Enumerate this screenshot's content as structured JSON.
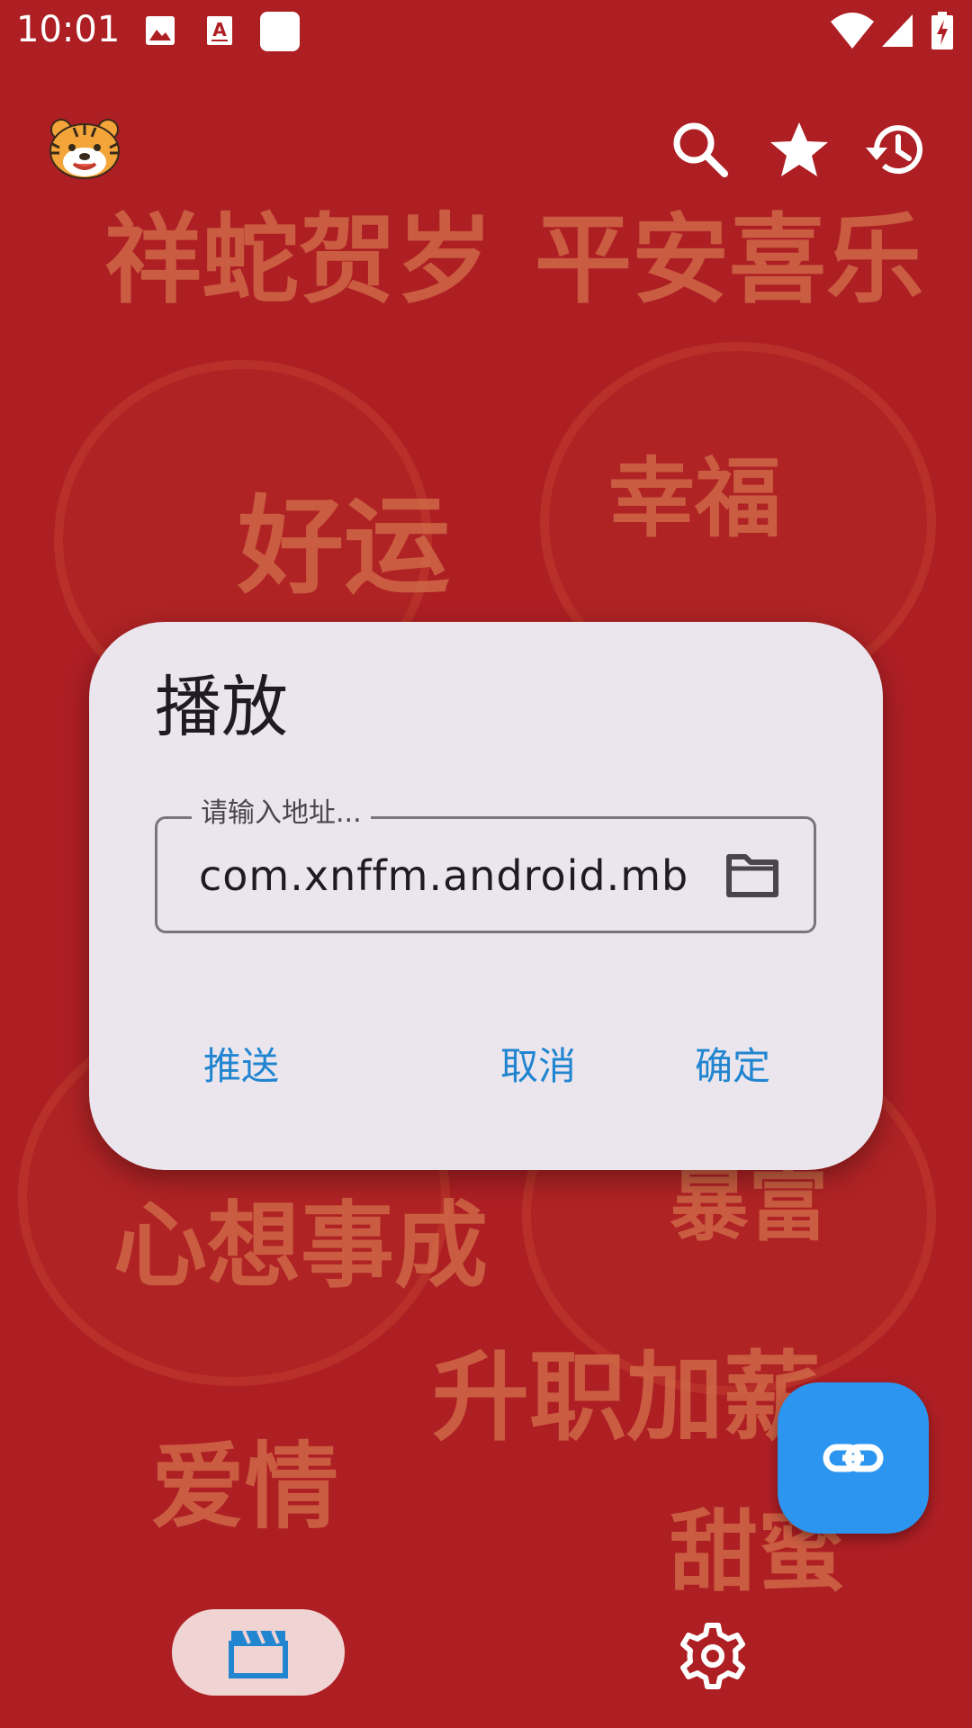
{
  "status_bar": {
    "time": "10:01",
    "notification_icons": [
      "image-icon",
      "text-a-icon",
      "white-square-icon"
    ],
    "system_icons": [
      "wifi-icon",
      "cell-signal-icon",
      "battery-charging-icon"
    ]
  },
  "app_bar": {
    "logo_icon": "tiger-logo-icon",
    "actions": [
      {
        "name": "search",
        "icon": "search-icon"
      },
      {
        "name": "favorites",
        "icon": "star-icon"
      },
      {
        "name": "history",
        "icon": "history-icon"
      }
    ]
  },
  "background": {
    "phrases": [
      "祥蛇贺岁",
      "平安喜乐",
      "好运",
      "幸福",
      "心想事成",
      "暴富",
      "升职加薪",
      "爱情",
      "甜蜜"
    ]
  },
  "dialog": {
    "title": "播放",
    "address_field": {
      "label": "请输入地址...",
      "value": "com.xnffm.android.mb",
      "folder_icon": "folder-icon"
    },
    "buttons": {
      "push": "推送",
      "cancel": "取消",
      "confirm": "确定"
    }
  },
  "fab": {
    "icon": "link-icon"
  },
  "bottom_nav": {
    "items": [
      {
        "name": "videos",
        "icon": "clapperboard-icon",
        "selected": true
      },
      {
        "name": "settings",
        "icon": "gear-icon",
        "selected": false
      }
    ]
  },
  "colors": {
    "background": "#ae1f24",
    "decor_text": "#d26e4a",
    "dialog_surface": "#ebe6ee",
    "dialog_button_text": "#2185d0",
    "fab": "#2b95ef",
    "nav_selected_pill": "#f0d4d4",
    "nav_selected_icon": "#2185d0"
  }
}
